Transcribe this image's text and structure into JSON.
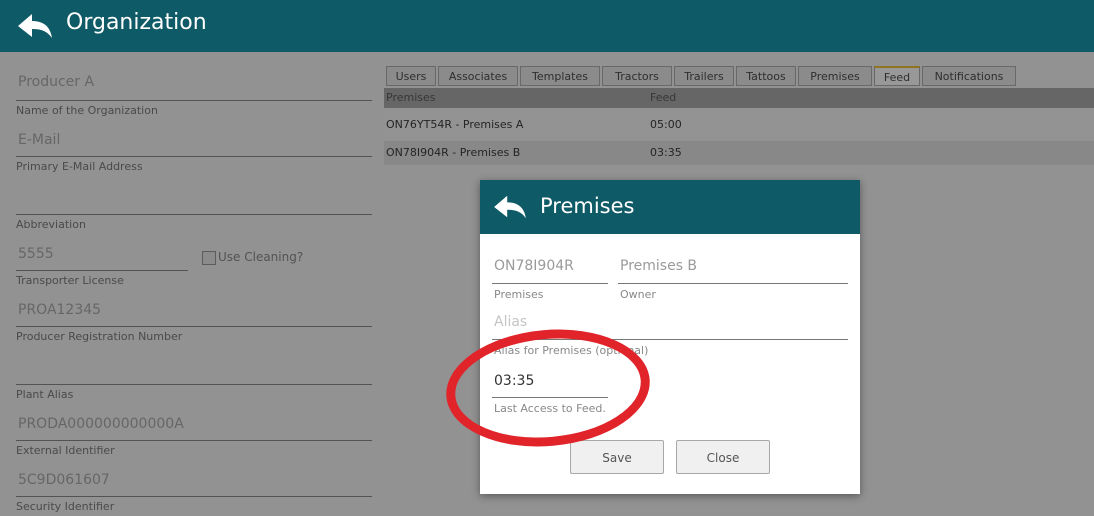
{
  "header": {
    "title": "Organization"
  },
  "form": {
    "name_value": "Producer A",
    "name_label": "Name of the Organization",
    "email_placeholder": "E-Mail",
    "email_label": "Primary E-Mail Address",
    "abbreviation_value": "",
    "abbreviation_label": "Abbreviation",
    "transporter_value": "5555",
    "use_cleaning_label": "Use Cleaning?",
    "transporter_label": "Transporter License",
    "producer_reg_value": "PROA12345",
    "producer_reg_label": "Producer Registration Number",
    "plant_alias_value": "",
    "plant_alias_label": "Plant Alias",
    "external_id_value": "PRODA000000000000A",
    "external_id_label": "External Identifier",
    "security_id_value": "5C9D061607",
    "security_id_label": "Security Identifier"
  },
  "tabs": [
    "Users",
    "Associates",
    "Templates",
    "Tractors",
    "Trailers",
    "Tattoos",
    "Premises",
    "Feed",
    "Notifications"
  ],
  "active_tab": "Feed",
  "grid": {
    "columns": [
      "Premises",
      "Feed"
    ],
    "rows": [
      [
        "ON76YT54R - Premises A",
        "05:00"
      ],
      [
        "ON78I904R - Premises B",
        "03:35"
      ]
    ]
  },
  "modal": {
    "title": "Premises",
    "premises_value": "ON78I904R",
    "premises_label": "Premises",
    "owner_value": "Premises B",
    "owner_label": "Owner",
    "alias_placeholder": "Alias",
    "alias_label": "Alias for Premises (optional)",
    "feed_value": "03:35",
    "feed_label": "Last Access to Feed.",
    "save_label": "Save",
    "close_label": "Close"
  },
  "colors": {
    "header": "#0e5a66",
    "highlight_circle": "#e0242a",
    "active_tab_accent": "#e8b318"
  },
  "icons": {
    "back": "back-arrow-icon"
  }
}
